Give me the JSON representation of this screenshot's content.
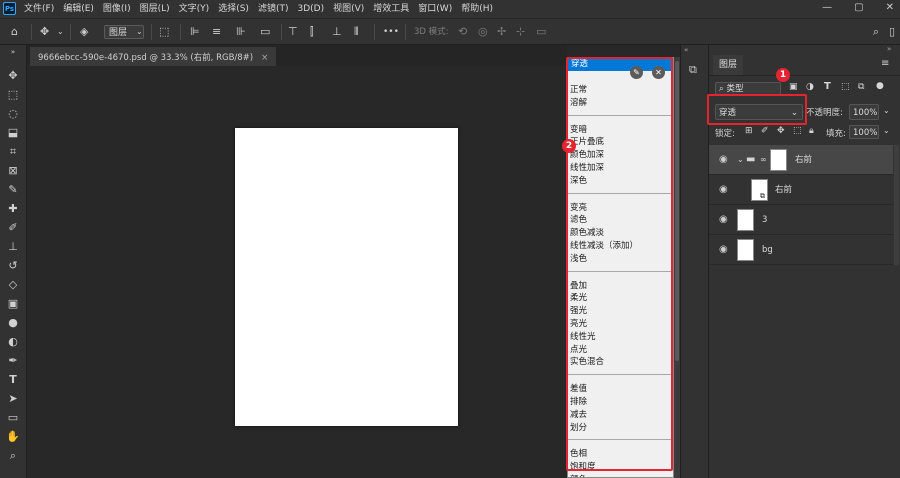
{
  "app": {
    "logo": "Ps"
  },
  "menu": [
    "文件(F)",
    "编辑(E)",
    "图像(I)",
    "图层(L)",
    "文字(Y)",
    "选择(S)",
    "滤镜(T)",
    "3D(D)",
    "视图(V)",
    "增效工具",
    "窗口(W)",
    "帮助(H)"
  ],
  "window_controls": [
    "—",
    "▢",
    "✕"
  ],
  "options_bar": {
    "layer_select": "图层",
    "mode_3d": "3D 模式:",
    "more": "•••"
  },
  "document": {
    "tab_title": "9666ebcc-590e-4670.psd @ 33.3% (右前, RGB/8#)",
    "tab_close": "×",
    "canvas_color": "#ffffff"
  },
  "blend_dropdown": {
    "selected": "穿透",
    "groups": [
      [
        "正常",
        "溶解"
      ],
      [
        "变暗",
        "正片叠底",
        "颜色加深",
        "线性加深",
        "深色"
      ],
      [
        "变亮",
        "滤色",
        "颜色减淡",
        "线性减淡（添加）",
        "浅色"
      ],
      [
        "叠加",
        "柔光",
        "强光",
        "亮光",
        "线性光",
        "点光",
        "实色混合"
      ],
      [
        "差值",
        "排除",
        "减去",
        "划分"
      ],
      [
        "色相",
        "饱和度",
        "颜色"
      ]
    ]
  },
  "annotations": {
    "badge1": "1",
    "badge2": "2",
    "color": "#e4252f"
  },
  "layers_panel": {
    "tab_label": "图层",
    "filter_label": "类型",
    "blend_mode": "穿透",
    "opacity_label": "不透明度:",
    "opacity_value": "100%",
    "lock_label": "锁定:",
    "fill_label": "填充:",
    "fill_value": "100%",
    "layers": [
      {
        "name": "右前",
        "kind": "group",
        "selected": true
      },
      {
        "name": "右前",
        "kind": "smart-object",
        "selected": false
      },
      {
        "name": "3",
        "kind": "pixel",
        "selected": false
      },
      {
        "name": "bg",
        "kind": "pixel",
        "selected": false
      }
    ]
  },
  "colors": {
    "dropdown_highlight": "#0078d7",
    "panel": "#323232",
    "selected_layer": "#4a4a4a"
  }
}
